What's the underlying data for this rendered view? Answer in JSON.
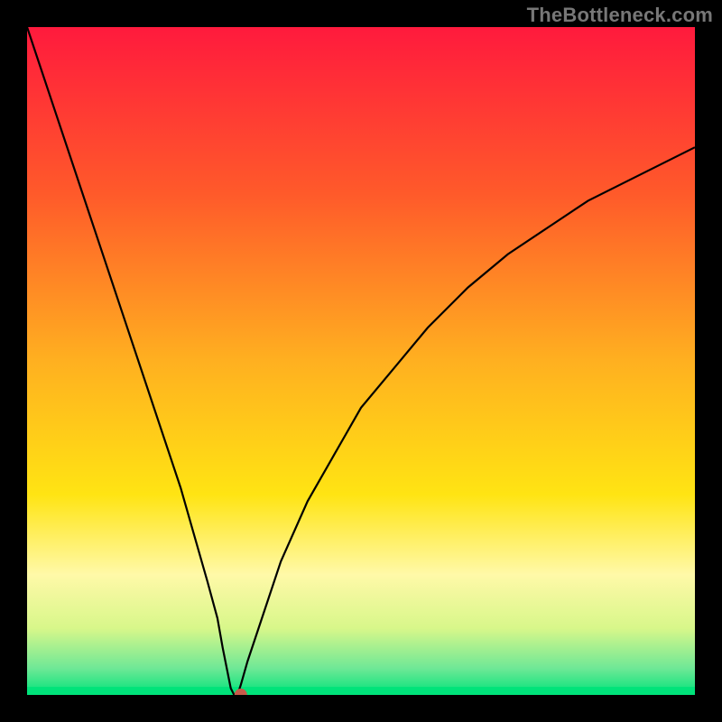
{
  "watermark": "TheBottleneck.com",
  "chart_data": {
    "type": "line",
    "title": "",
    "xlabel": "",
    "ylabel": "",
    "xlim": [
      0,
      100
    ],
    "ylim": [
      0,
      100
    ],
    "grid": false,
    "background_gradient": {
      "stops": [
        {
          "offset": 0.0,
          "color": "#ff1a3d"
        },
        {
          "offset": 0.25,
          "color": "#ff5a2a"
        },
        {
          "offset": 0.5,
          "color": "#ffb020"
        },
        {
          "offset": 0.7,
          "color": "#ffe413"
        },
        {
          "offset": 0.82,
          "color": "#fff9a8"
        },
        {
          "offset": 0.9,
          "color": "#d8f78a"
        },
        {
          "offset": 0.96,
          "color": "#6fe896"
        },
        {
          "offset": 1.0,
          "color": "#00e37a"
        }
      ]
    },
    "series": [
      {
        "name": "bottleneck-curve",
        "color": "#000000",
        "x": [
          0,
          2,
          5,
          8,
          11,
          14,
          17,
          20,
          23,
          25,
          27,
          28.5,
          29.3,
          30,
          30.5,
          31,
          31.5,
          32,
          33,
          35,
          38,
          42,
          46,
          50,
          55,
          60,
          66,
          72,
          78,
          84,
          90,
          95,
          100
        ],
        "values": [
          100,
          94,
          85,
          76,
          67,
          58,
          49,
          40,
          31,
          24,
          17,
          11.5,
          7,
          3.5,
          1,
          0,
          0,
          1.5,
          5,
          11,
          20,
          29,
          36,
          43,
          49,
          55,
          61,
          66,
          70,
          74,
          77,
          79.5,
          82
        ]
      }
    ],
    "markers": [
      {
        "name": "optimal-point",
        "x": 32,
        "y": 0,
        "color": "#c75a4a",
        "radius": 7
      }
    ],
    "baseline_band": {
      "y": 0,
      "height": 1.2,
      "color": "#00e37a"
    }
  }
}
